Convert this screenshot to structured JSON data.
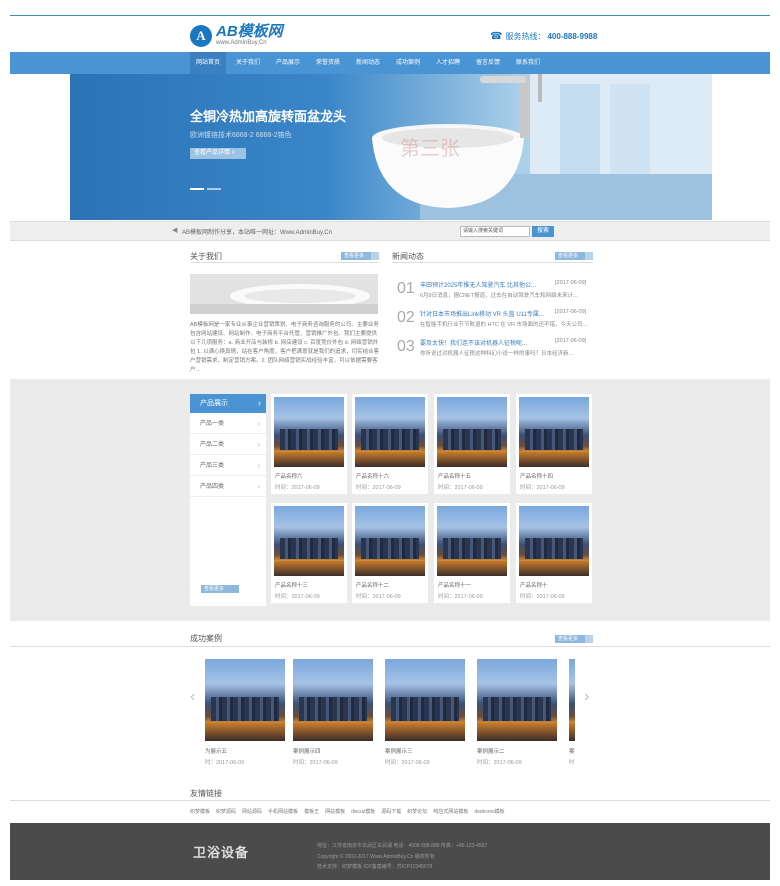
{
  "header": {
    "logo_letter": "A",
    "logo_title": "AB模板网",
    "logo_sub": "www.AdminBuy.Cn",
    "hotline_label": "服务热线：",
    "hotline_number": "400-888-9988"
  },
  "nav": {
    "items": [
      "网站首页",
      "关于我们",
      "产品展示",
      "荣誉资质",
      "新闻动态",
      "成功案例",
      "人才招聘",
      "留言反馈",
      "联系我们"
    ]
  },
  "banner": {
    "title": "全铜冷热加高旋转面盆龙头",
    "subtitle": "欧洲镀铬技术6868-2 6868-2铬色",
    "button": "查看产品详情 >",
    "watermark": "第三张"
  },
  "notice": {
    "text": "AB模板网制作分享，本站唯一网址：Www.AdminBuy.Cn",
    "search_placeholder": "请输入搜索关键词",
    "search_button": "搜索"
  },
  "about": {
    "title": "关于我们",
    "more": "查看更多",
    "text": "AB模板网是一家专业从事企业营销策划、电子商务咨询服务的公司。主要业务包含网站建设、网站制作、电子商务平台托管、营销推广外包、我们主要提供以下几项服务：a. 商业开店与装修 b. 网店建设 c. 百度竞价外包 d. 网络营销外包 1. 以满心换真情，站在客户角度，客户把满意就是我们的追求，切实结合客户营销需求，制定营销方案。2. 团队网络营销实战经验丰富，可以依据需要客户…"
  },
  "news": {
    "title": "新闻动态",
    "more": "查看更多",
    "items": [
      {
        "num": "01",
        "title": "丰田预计2025年推无人驾驶汽车 比其他公...",
        "date": "[2017-06-09]",
        "desc": "6月9日消息，据CNET报道，过去在自动驾驶汽车和网络未来计..."
      },
      {
        "num": "02",
        "title": "针对日本市场推出Link移动 VR 头盔 U11专属...",
        "date": "[2017-06-09]",
        "desc": "在智能手机行业节节败退的 HTC 在 VR 市场面的还不错，今天公司..."
      },
      {
        "num": "03",
        "title": "要及太快！我们连不该对机器人征税呢...",
        "date": "[2017-06-09]",
        "desc": "你听说过对机器人征税这种科幻小说一样的事吗？日本经济新..."
      }
    ]
  },
  "products": {
    "category_title": "产品展示",
    "categories": [
      "产品一类",
      "产品二类",
      "产品三类",
      "产品四类"
    ],
    "more": "查看更多",
    "items": [
      {
        "name": "产品名称六",
        "time": "时间：2017-06-09"
      },
      {
        "name": "产品名称十六",
        "time": "时间：2017-06-09"
      },
      {
        "name": "产品名称十五",
        "time": "时间：2017-06-09"
      },
      {
        "name": "产品名称十四",
        "time": "时间：2017-06-09"
      },
      {
        "name": "产品名称十三",
        "time": "时间：2017-06-09"
      },
      {
        "name": "产品名称十二",
        "time": "时间：2017-06-09"
      },
      {
        "name": "产品名称十一",
        "time": "时间：2017-06-09"
      },
      {
        "name": "产品名称十",
        "time": "时间：2017-06-09"
      }
    ]
  },
  "cases": {
    "title": "成功案例",
    "more": "查看更多",
    "prev": "‹",
    "next": "›",
    "items": [
      {
        "name": "为展示五",
        "time": "时：2017-06-09"
      },
      {
        "name": "案例展示四",
        "time": "时间：2017-06-09"
      },
      {
        "name": "案例展示三",
        "time": "时间：2017-06-09"
      },
      {
        "name": "案例展示二",
        "time": "时间：2017-06-09"
      },
      {
        "name": "案",
        "time": "时"
      }
    ]
  },
  "links": {
    "title": "友情链接",
    "items": [
      "织梦模板",
      "织梦源码",
      "网站源码",
      "手机网站模板",
      "模板王",
      "网站模板",
      "discuz模板",
      "源码下载",
      "织梦论坛",
      "响应式网站模板",
      "dedecms模板"
    ]
  },
  "footer": {
    "logo": "卫浴设备",
    "line1": "地址：江苏省南京市玄武区玄武湖   电话：4008-888-888   传真：+86-123-4567",
    "line2": "Copyright © 2002-2017 Www.AdminBuy.Cn 版权所有",
    "line3": "技术支持：织梦模板 ICP备案编号：苏ICP12345678"
  },
  "colors": {
    "accent": "#4a94d4",
    "footer_bg": "#4b4b4b",
    "band_bg": "#ebebeb"
  }
}
